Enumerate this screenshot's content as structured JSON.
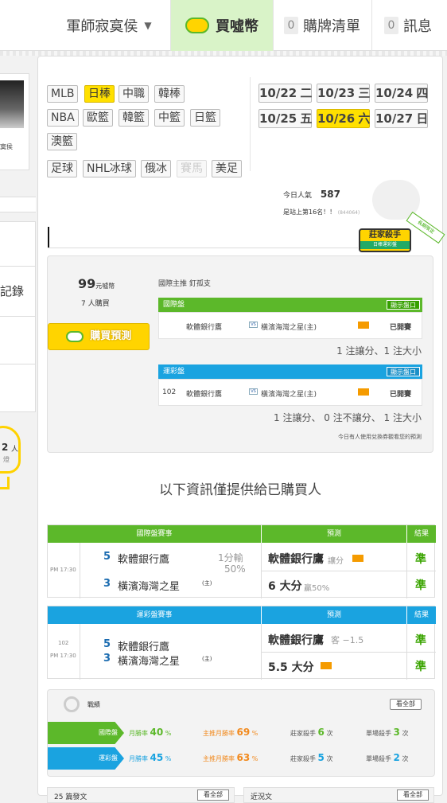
{
  "topbar": {
    "user": "軍師寂寞侯",
    "buy_coins": "買噓幣",
    "cart_count": "0",
    "cart_label": "購牌清單",
    "msg_count": "0",
    "msg_label": "訊息"
  },
  "left": {
    "avatar_caption": "寞侯",
    "record_label": "記錄",
    "bulb_count": "2",
    "bulb_unit": "人",
    "bulb_caption": "燈"
  },
  "sports": {
    "row1": [
      "MLB",
      "日棒",
      "中職",
      "韓棒"
    ],
    "row2": [
      "NBA",
      "歐籃",
      "韓籃",
      "中籃",
      "日籃"
    ],
    "row3": [
      "澳籃"
    ],
    "row4": [
      "足球",
      "NHL冰球",
      "俄冰",
      "賽馬",
      "美足"
    ]
  },
  "dates": [
    {
      "d": "10/22",
      "w": "二"
    },
    {
      "d": "10/23",
      "w": "三"
    },
    {
      "d": "10/24",
      "w": "四"
    },
    {
      "d": "10/25",
      "w": "五"
    },
    {
      "d": "10/26",
      "w": "六"
    },
    {
      "d": "10/27",
      "w": "日"
    }
  ],
  "popularity": {
    "label": "今日人氣",
    "value": "587",
    "rank": "是站上第16名！！",
    "small": "(844064)"
  },
  "badge": {
    "title": "莊家殺手",
    "sub": "日棒運彩盤",
    "ribbon": "長期限定"
  },
  "prediction": {
    "price": "99",
    "price_unit": "元噓幣",
    "buyers": "7 人購買",
    "buy_button": "購買預測",
    "tip_title": "國際主推 釘孤支",
    "intl": {
      "label": "國際盤",
      "show": "顯示盤口",
      "home": "軟體銀行鷹",
      "away": "橫濱海灣之星(主)",
      "status": "已開賽",
      "summary": "1 注讓分、1 注大小"
    },
    "lottery": {
      "label": "運彩盤",
      "show": "顯示盤口",
      "no": "102",
      "home": "軟體銀行鷹",
      "away": "橫濱海灣之星(主)",
      "status": "已開賽",
      "summary": "1 注讓分、 0 注不讓分、 1 注大小"
    },
    "note": "今日有人使用兌換券觀看您的預測"
  },
  "info_title": "以下資訊僅提供給已購買人",
  "intl_table": {
    "col1": "國際盤賽事",
    "col2": "預測",
    "col3": "結果",
    "time": "PM 17:30",
    "team1_no": "5",
    "team1": "軟體銀行鷹",
    "team2_no": "3",
    "team2": "橫濱海灣之星",
    "host": "(主)",
    "line1": "1分輸",
    "line2": "50%",
    "pick1": "軟體銀行鷹",
    "pick1_type": "讓分",
    "pick2": "6 大分",
    "pick2_odds": "贏50%",
    "result1": "準",
    "result2": "準"
  },
  "lottery_table": {
    "col1": "運彩盤賽事",
    "col2": "預測",
    "col3": "結果",
    "no": "102",
    "time": "PM 17:30",
    "team1_no": "5",
    "team1": "軟體銀行鷹",
    "team2_no": "3",
    "team2": "橫濱海灣之星",
    "host": "(主)",
    "pick1": "軟體銀行鷹",
    "pick1_type": "客 −1.5",
    "pick2": "5.5 大分",
    "result1": "準",
    "result2": "準"
  },
  "record": {
    "title": "戰績",
    "see_all": "看全部",
    "rows": [
      {
        "label": "國際盤",
        "m1": "月勝率",
        "v1": "40",
        "m2": "主推月勝率",
        "v2": "69",
        "m3": "莊家殺手",
        "v3": "6",
        "m4": "單場殺手",
        "v4": "3"
      },
      {
        "label": "運彩盤",
        "m1": "月勝率",
        "v1": "45",
        "m2": "主推月勝率",
        "v2": "63",
        "m3": "莊家殺手",
        "v3": "5",
        "m4": "單場殺手",
        "v4": "2"
      }
    ],
    "pct": "%",
    "times": "次"
  },
  "bottom": {
    "left_title": "25 篇發文",
    "left_see": "看全部",
    "right_title": "近況文",
    "right_see": "看全部"
  },
  "colors": {
    "green": "#5cb82a",
    "blue": "#1aa3e0",
    "yellow": "#ffe000",
    "orange": "#f28a1e"
  }
}
